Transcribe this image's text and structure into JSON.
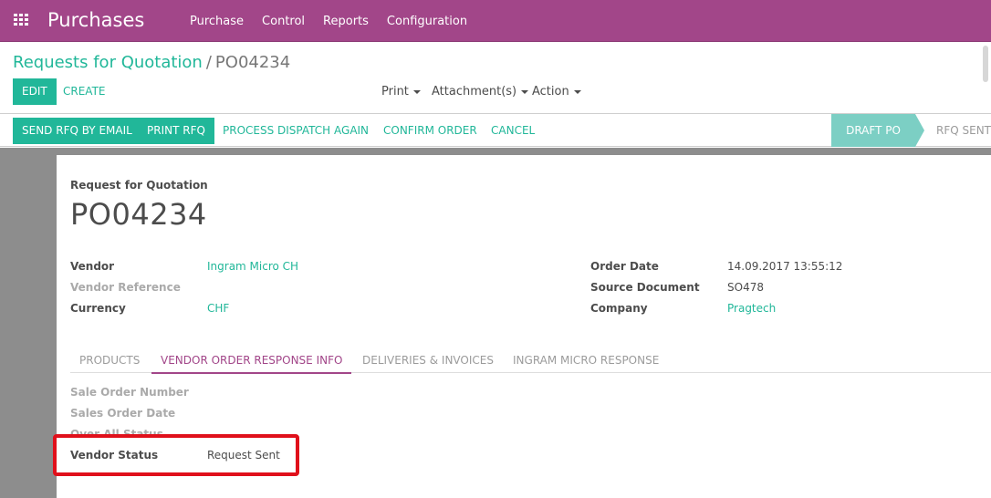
{
  "navbar": {
    "brand": "Purchases",
    "menu": [
      "Purchase",
      "Control",
      "Reports",
      "Configuration"
    ]
  },
  "breadcrumb": {
    "parent": "Requests for Quotation",
    "separator": "/",
    "current": "PO04234"
  },
  "control": {
    "edit": "EDIT",
    "create": "CREATE",
    "print": "Print",
    "attachments": "Attachment(s)",
    "action": "Action"
  },
  "statusbar": {
    "send_rfq": "SEND RFQ BY EMAIL",
    "print_rfq": "PRINT RFQ",
    "process_dispatch": "PROCESS DISPATCH AGAIN",
    "confirm_order": "CONFIRM ORDER",
    "cancel": "CANCEL",
    "stage_active": "DRAFT PO",
    "stage_next": "RFQ SENT"
  },
  "form": {
    "doc_kind": "Request for Quotation",
    "doc_name": "PO04234",
    "left": [
      {
        "label": "Vendor",
        "value": "Ingram Micro CH"
      },
      {
        "label": "Vendor Reference",
        "value": ""
      },
      {
        "label": "Currency",
        "value": "CHF"
      }
    ],
    "right": [
      {
        "label": "Order Date",
        "value": "14.09.2017 13:55:12"
      },
      {
        "label": "Source Document",
        "value": "SO478"
      },
      {
        "label": "Company",
        "value": "Pragtech"
      }
    ]
  },
  "tabs": [
    "PRODUCTS",
    "VENDOR ORDER RESPONSE INFO",
    "DELIVERIES & INVOICES",
    "INGRAM MICRO RESPONSE"
  ],
  "vendor_info": {
    "sale_order_number": "Sale Order Number",
    "sales_order_date": "Sales Order Date",
    "over_all_status": "Over All Status",
    "vendor_status_label": "Vendor Status",
    "vendor_status_value": "Request Sent"
  },
  "colors": {
    "navbar": "#a24689",
    "accent": "#21b799",
    "highlight": "#e0101b"
  }
}
